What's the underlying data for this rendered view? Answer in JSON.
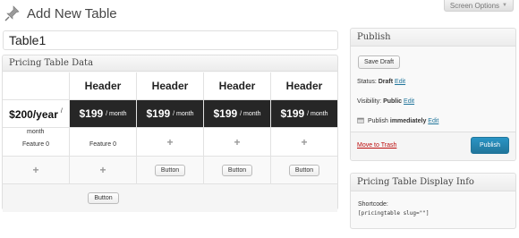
{
  "page": {
    "title": "Add New Table",
    "screen_options": "Screen Options"
  },
  "post_title": {
    "value": "Table1"
  },
  "pricing_table": {
    "heading": "Pricing Table Data",
    "headers": [
      "Header",
      "Header",
      "Header",
      "Header"
    ],
    "first_col_price": "$200/year",
    "first_col_per": "/",
    "first_col_month": "month",
    "prices": [
      {
        "amount": "$199",
        "per": "/ month"
      },
      {
        "amount": "$199",
        "per": "/ month"
      },
      {
        "amount": "$199",
        "per": "/ month"
      },
      {
        "amount": "$199",
        "per": "/ month"
      }
    ],
    "features": [
      "Feature 0",
      "Feature 0"
    ],
    "add_symbol": "+",
    "button_label": "Button"
  },
  "publish": {
    "heading": "Publish",
    "save_draft": "Save Draft",
    "status_label": "Status:",
    "status_value": "Draft",
    "visibility_label": "Visibility:",
    "visibility_value": "Public",
    "publish_label": "Publish",
    "publish_value": "immediately",
    "edit": "Edit",
    "trash": "Move to Trash",
    "publish_button": "Publish",
    "colors": {
      "primary": "#21759b",
      "trash": "#bc0b0b"
    }
  },
  "display_info": {
    "heading": "Pricing Table Display Info",
    "shortcode_label": "Shortcode:",
    "shortcode_value": "[pricingtable slug=\"\"]"
  },
  "icons": {
    "title": "pushpin-icon",
    "schedule": "calendar-icon",
    "options": "triangle-down-icon"
  }
}
